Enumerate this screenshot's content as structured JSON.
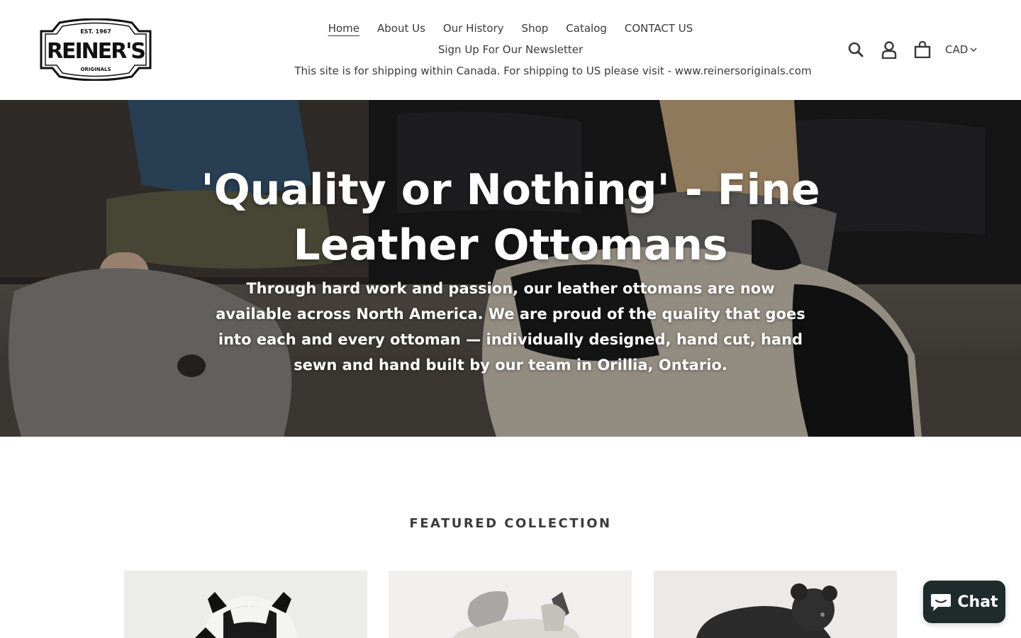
{
  "brand": {
    "logo_top": "EST. 1967",
    "logo_main": "REINER'S",
    "logo_bottom": "ORIGINALS"
  },
  "nav": {
    "row1": [
      "Home",
      "About Us",
      "Our History",
      "Shop",
      "Catalog",
      "CONTACT US"
    ],
    "row2": [
      "Sign Up For Our Newsletter"
    ],
    "notice": "This site is for shipping within Canada. For shipping to US please visit - www.reinersoriginals.com",
    "active": "Home"
  },
  "header": {
    "icons": [
      "search-icon",
      "account-icon",
      "cart-icon"
    ],
    "currency": "CAD"
  },
  "hero": {
    "title": "'Quality or Nothing' - Fine Leather Ottomans",
    "subtitle": "Through hard work and passion, our leather ottomans are now available across North America. We are proud of the quality that goes into each and every ottoman — individually designed, hand cut, hand sewn and hand built by our team in Orillia, Ontario."
  },
  "featured": {
    "heading": "FEATURED COLLECTION",
    "products": [
      "cow ottoman",
      "grey donkey ottoman",
      "black bear ottoman"
    ]
  },
  "chat": {
    "label": "Chat"
  },
  "colors": {
    "text": "#3a3a3a",
    "chat_bg": "#1f2a2a",
    "hero_tint": "#3b3936"
  }
}
